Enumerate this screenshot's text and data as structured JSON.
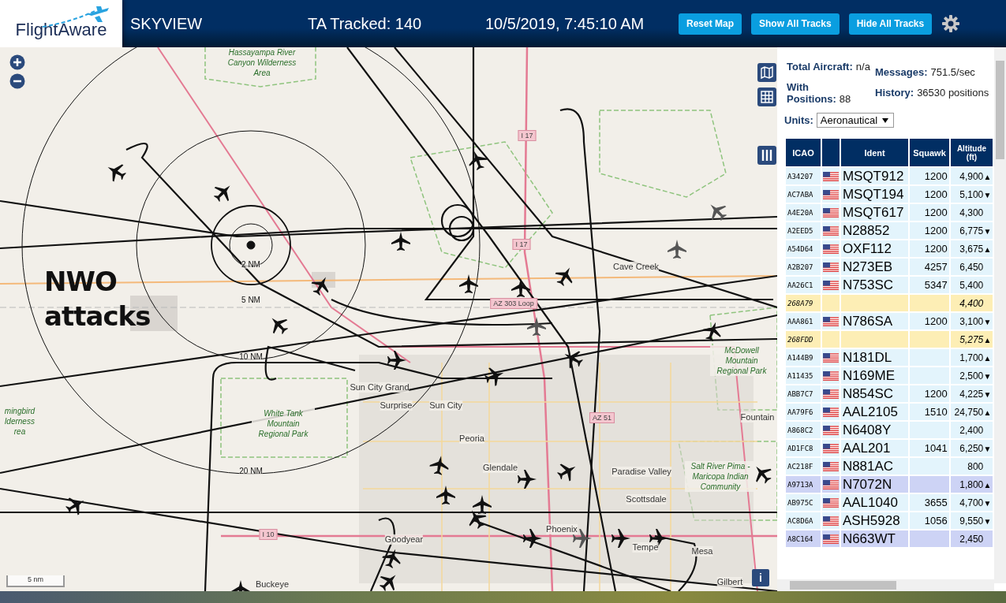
{
  "header": {
    "logo": "FlightAware",
    "title": "SKYVIEW",
    "tracked": "TA Tracked: 140",
    "datetime": "10/5/2019, 7:45:10 AM",
    "buttons": [
      "Reset Map",
      "Show All Tracks",
      "Hide All Tracks"
    ]
  },
  "map": {
    "overlay_text": "NWO attacks",
    "range_labels": [
      "2 NM",
      "5 NM",
      "10 NM",
      "20 NM"
    ],
    "places": [
      "Hassayampa River Canyon Wilderness Area",
      "Cave Creek",
      "McDowell Mountain Regional Park",
      "Sun City Grand",
      "Surprise",
      "Sun City",
      "mingbird lderness rea",
      "White Tank Mountain Regional Park",
      "Fountain",
      "Peoria",
      "Glendale",
      "Paradise Valley",
      "Scottsdale",
      "Salt River Pima - Maricopa Indian Community",
      "Phoenix",
      "Tempe",
      "Mesa",
      "Goodyear",
      "Buckeye",
      "Gilbert"
    ],
    "road_shields": [
      "I 17",
      "I 17",
      "AZ 303 Loop",
      "AZ 51",
      "I 10"
    ],
    "scale": "5 nm",
    "info_button": "i"
  },
  "stats": [
    {
      "label": "Total Aircraft:",
      "value": "n/a"
    },
    {
      "label": "Messages:",
      "value": "751.5/sec"
    },
    {
      "label": "With Positions:",
      "value": "88"
    },
    {
      "label": "History:",
      "value": "36530 positions"
    }
  ],
  "units": {
    "label": "Units:",
    "value": "Aeronautical"
  },
  "table": {
    "columns": [
      "ICAO",
      "Ident",
      "Squawk",
      "Altitude (ft)"
    ],
    "rows": [
      {
        "icao": "A34207",
        "flag": true,
        "ident": "MSQT912",
        "squawk": "1200",
        "altitude": "4,900",
        "trend": "▲",
        "kind": "normal"
      },
      {
        "icao": "AC7ABA",
        "flag": true,
        "ident": "MSQT194",
        "squawk": "1200",
        "altitude": "5,100",
        "trend": "▼",
        "kind": "normal"
      },
      {
        "icao": "A4E20A",
        "flag": true,
        "ident": "MSQT617",
        "squawk": "1200",
        "altitude": "4,300",
        "kind": "normal"
      },
      {
        "icao": "A2EED5",
        "flag": true,
        "ident": "N28852",
        "squawk": "1200",
        "altitude": "6,775",
        "trend": "▼",
        "kind": "normal"
      },
      {
        "icao": "A54D64",
        "flag": true,
        "ident": "OXF112",
        "squawk": "1200",
        "altitude": "3,675",
        "trend": "▲",
        "kind": "normal"
      },
      {
        "icao": "A2B207",
        "flag": true,
        "ident": "N273EB",
        "squawk": "4257",
        "altitude": "6,450",
        "kind": "normal"
      },
      {
        "icao": "AA26C1",
        "flag": true,
        "ident": "N753SC",
        "squawk": "5347",
        "altitude": "5,400",
        "kind": "normal"
      },
      {
        "icao": "268A79",
        "flag": false,
        "altitude": "4,400",
        "kind": "mlat"
      },
      {
        "icao": "AAA861",
        "flag": true,
        "ident": "N786SA",
        "squawk": "1200",
        "altitude": "3,100",
        "trend": "▼",
        "kind": "normal"
      },
      {
        "icao": "268FDD",
        "flag": false,
        "altitude": "5,275",
        "trend": "▲",
        "kind": "mlat"
      },
      {
        "icao": "A144B9",
        "flag": true,
        "ident": "N181DL",
        "altitude": "1,700",
        "trend": "▲",
        "kind": "normal"
      },
      {
        "icao": "A11435",
        "flag": true,
        "ident": "N169ME",
        "altitude": "2,500",
        "trend": "▼",
        "kind": "normal"
      },
      {
        "icao": "ABB7C7",
        "flag": true,
        "ident": "N854SC",
        "squawk": "1200",
        "altitude": "4,225",
        "trend": "▼",
        "kind": "normal"
      },
      {
        "icao": "AA79F6",
        "flag": true,
        "ident": "AAL2105",
        "squawk": "1510",
        "altitude": "24,750",
        "trend": "▲",
        "kind": "normal"
      },
      {
        "icao": "A868C2",
        "flag": true,
        "ident": "N6408Y",
        "altitude": "2,400",
        "kind": "normal"
      },
      {
        "icao": "AD1FC8",
        "flag": true,
        "ident": "AAL201",
        "squawk": "1041",
        "altitude": "6,250",
        "trend": "▼",
        "kind": "normal"
      },
      {
        "icao": "AC218F",
        "flag": true,
        "ident": "N881AC",
        "altitude": "800",
        "kind": "normal"
      },
      {
        "icao": "A9713A",
        "flag": true,
        "ident": "N7072N",
        "altitude": "1,800",
        "trend": "▲",
        "kind": "tisb"
      },
      {
        "icao": "AB975C",
        "flag": true,
        "ident": "AAL1040",
        "squawk": "3655",
        "altitude": "4,700",
        "trend": "▼",
        "kind": "normal"
      },
      {
        "icao": "AC8D6A",
        "flag": true,
        "ident": "ASH5928",
        "squawk": "1056",
        "altitude": "9,550",
        "trend": "▼",
        "kind": "normal"
      },
      {
        "icao": "A8C164",
        "flag": true,
        "ident": "N663WT",
        "altitude": "2,450",
        "kind": "tisb"
      }
    ]
  }
}
